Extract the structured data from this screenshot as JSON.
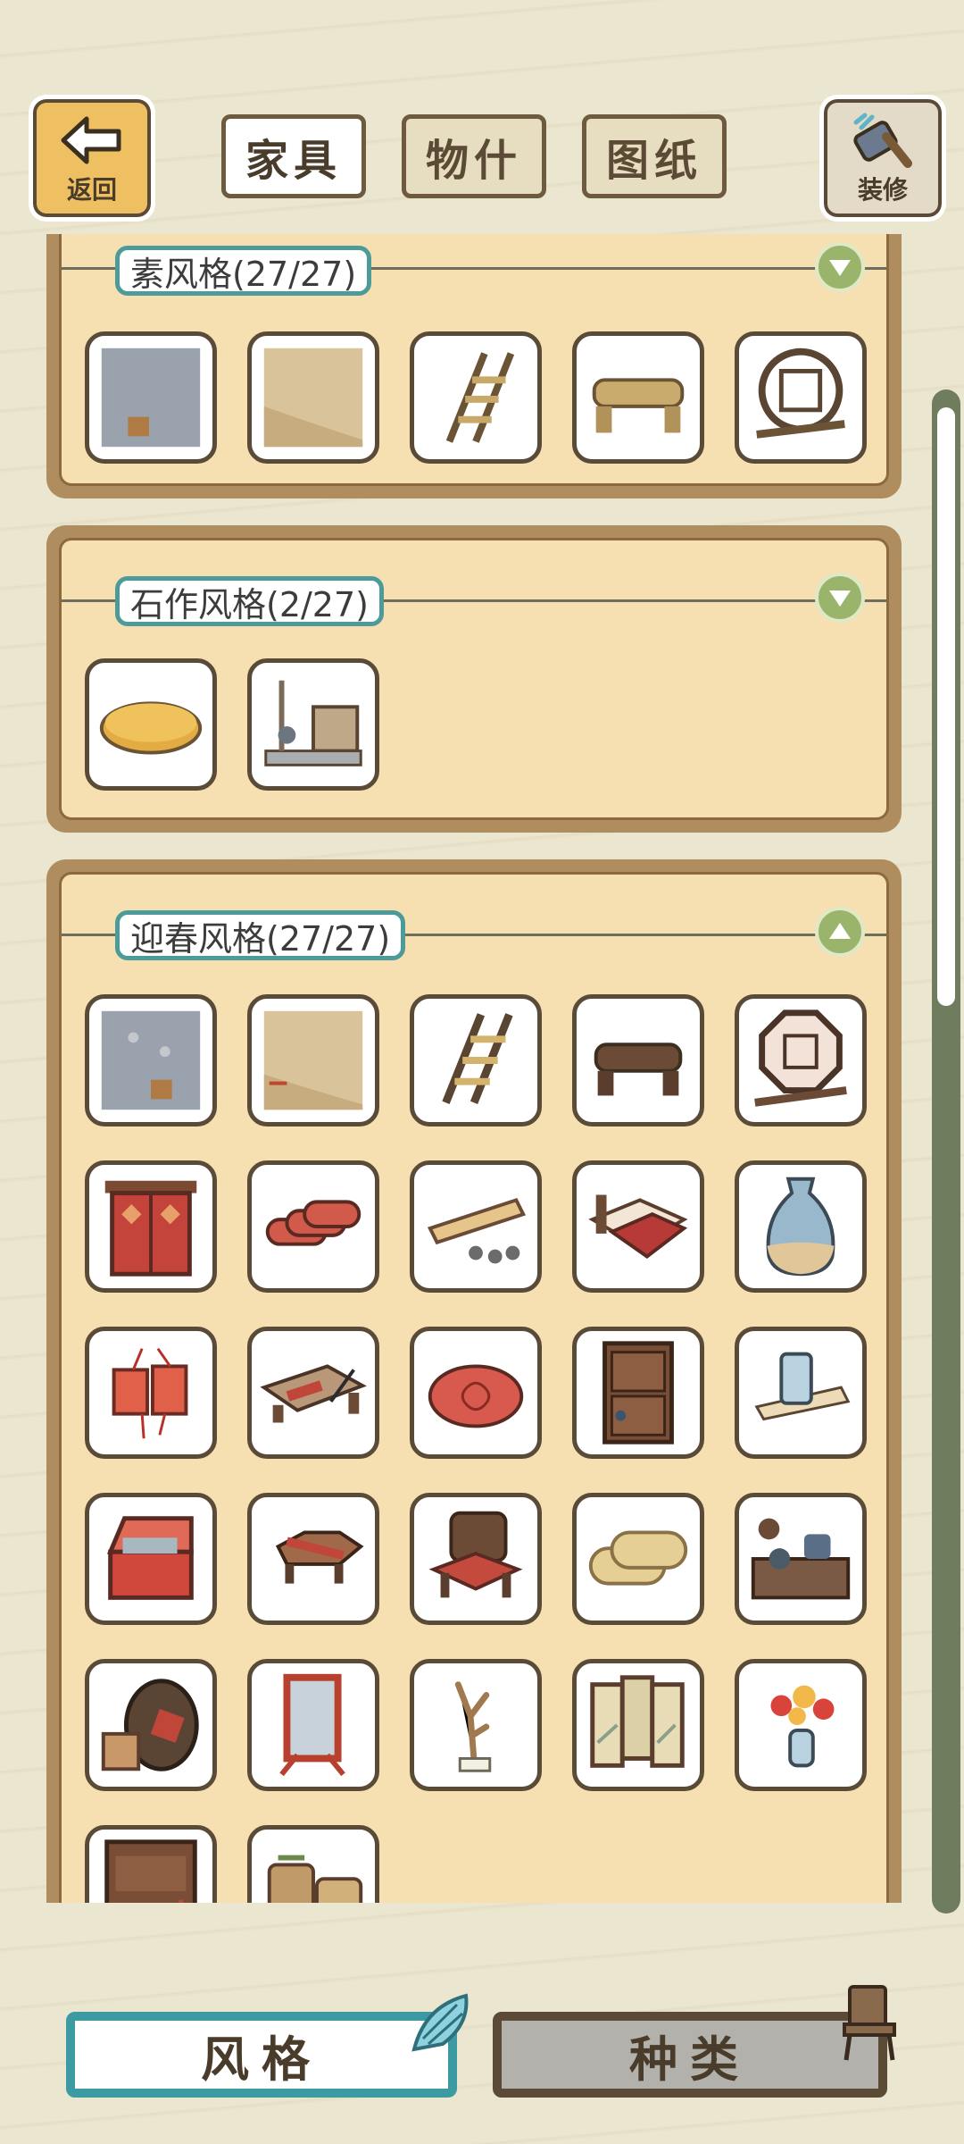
{
  "header": {
    "back_label": "返回",
    "decorate_label": "装修",
    "tabs": [
      {
        "label": "家具",
        "active": true
      },
      {
        "label": "物什",
        "active": false
      },
      {
        "label": "图纸",
        "active": false
      }
    ]
  },
  "sections": [
    {
      "title": "素风格(27/27)",
      "expanded": false,
      "items": [
        "wall-panel-icon",
        "floor-panel-icon",
        "ladder-icon",
        "log-bench-icon",
        "round-lattice-window-icon"
      ]
    },
    {
      "title": "石作风格(2/27)",
      "expanded": false,
      "items": [
        "stone-disc-icon",
        "stone-workbench-icon"
      ]
    },
    {
      "title": "迎春风格(27/27)",
      "expanded": true,
      "items": [
        "wall-panel-icon",
        "floor-panel-icon",
        "ladder-icon",
        "log-bench-icon",
        "octagon-lattice-window-icon",
        "red-door-icon",
        "rolled-scrolls-icon",
        "scroll-painting-icon",
        "red-bed-icon",
        "blue-vase-icon",
        "red-charms-icon",
        "calligraphy-desk-icon",
        "round-red-cushion-icon",
        "wooden-cabinet-icon",
        "brush-pot-icon",
        "red-chest-icon",
        "low-red-table-icon",
        "red-chair-icon",
        "rolled-mats-icon",
        "tea-stove-icon",
        "wine-jar-icon",
        "standing-mirror-icon",
        "branch-ornament-icon",
        "folding-screen-icon",
        "flower-vase-icon",
        "red-cupboard-icon",
        "straw-baskets-icon"
      ]
    }
  ],
  "bottom": {
    "style_label": "风格",
    "type_label": "种类"
  },
  "colors": {
    "background": "#ebe6cf",
    "panel": "#f6dfb0",
    "panel_border": "#b08d5e",
    "title_border": "#4d9b98",
    "toggle": "#9bb46c",
    "active_bottom_border": "#3c9aa3"
  }
}
